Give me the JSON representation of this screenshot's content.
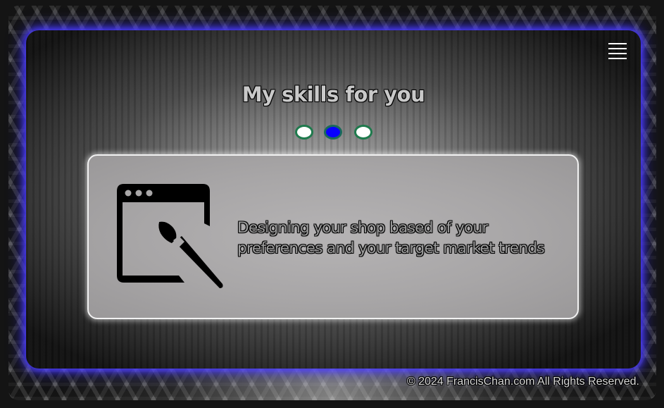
{
  "header": {
    "menu_icon": "hamburger-menu-icon",
    "title": "My skills for you"
  },
  "carousel": {
    "dots": [
      {
        "active": false
      },
      {
        "active": true
      },
      {
        "active": false
      }
    ],
    "active_index": 1,
    "colors": {
      "active": "#0800ff",
      "inactive": "#ffffff",
      "border": "#1f7a4d"
    }
  },
  "skill": {
    "icon": "web-design-paintbrush-icon",
    "text": "Designing your shop based of your preferences and your target market trends"
  },
  "footer": {
    "copyright": "© 2024 FrancisChan.com All Rights Reserved."
  },
  "colors": {
    "panel_glow": "#4b3cff",
    "card_border": "#f2f2f2"
  }
}
